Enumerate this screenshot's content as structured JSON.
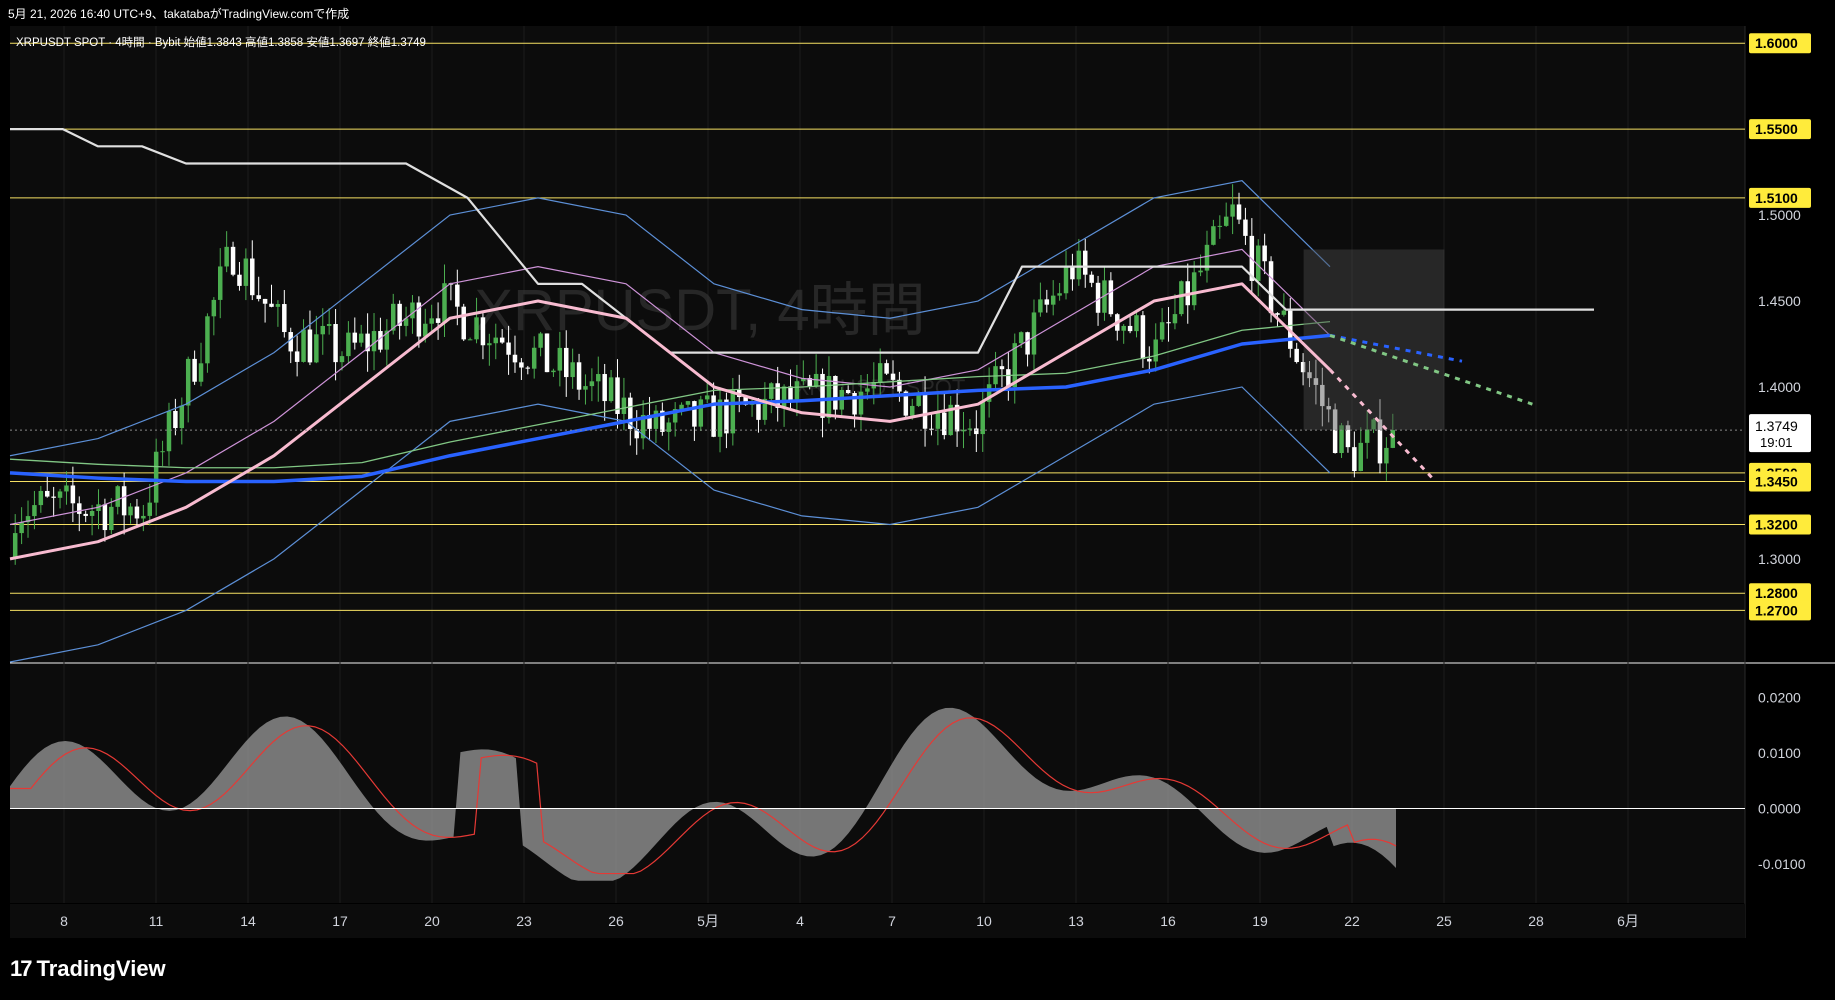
{
  "header": {
    "created_line": "5月 21, 2026 16:40 UTC+9、takatabaがTradingView.comで作成"
  },
  "legend": {
    "symbol": "XRPUSDT SPOT · 4時間 · Bybit",
    "open_label": "始値",
    "open": "1.3843",
    "high_label": "高値",
    "high": "1.3858",
    "low_label": "安値",
    "low": "1.3697",
    "close_label": "終値",
    "close": "1.3749"
  },
  "watermark": {
    "main": "XRPUSDT, 4時間",
    "sub": "XRPUSDT SPOT"
  },
  "footer": {
    "brand": "TradingView",
    "logo_icon": "tradingview-logo-icon"
  },
  "colors": {
    "background": "#000000",
    "pane_bg": "#0c0c0c",
    "grid": "#1c1c1c",
    "level_line": "#f5e063",
    "level_label_bg": "#ffeb3b",
    "bull_candle": "#4caf50",
    "bear_candle": "#ffffff",
    "ma_blue": "#2962ff",
    "ma_pink": "#f8bbd0",
    "ma_green": "#81c784",
    "ma_purple": "#ce93d8",
    "ma_white": "#e0e0e0",
    "bollinger": "#5c8fd6",
    "cloud": "#4a4a4a",
    "osc_fill": "#8a8a8a",
    "osc_signal": "#e53935",
    "price_label_bg": "#ffffff"
  },
  "chart_data": [
    {
      "type": "line",
      "pane": "price",
      "x_ticks": [
        "8",
        "11",
        "14",
        "17",
        "20",
        "23",
        "26",
        "5月",
        "4",
        "7",
        "10",
        "13",
        "16",
        "19",
        "22",
        "25",
        "28",
        "6月"
      ],
      "y_ticks": [
        "1.3000",
        "1.4000",
        "1.4500",
        "1.5000"
      ],
      "ylim": [
        1.24,
        1.61
      ],
      "horizontal_levels": [
        1.6,
        1.55,
        1.51,
        1.35,
        1.345,
        1.32,
        1.28,
        1.27
      ],
      "level_labels": [
        "1.6000",
        "1.5500",
        "1.5100",
        "1.3500",
        "1.3450",
        "1.3200",
        "1.2800",
        "1.2700"
      ],
      "current_price": {
        "value": 1.3749,
        "label": "1.3749",
        "countdown": "19:01"
      },
      "series": [
        {
          "name": "",
          "color_key": "ma_white",
          "x": [
            0,
            0.6,
            1,
            1.5,
            2,
            3,
            4.5,
            5.2,
            6,
            6.5,
            7.5,
            8.5,
            9,
            10,
            11,
            11.5,
            12,
            13,
            13.5,
            14,
            14.5,
            15,
            16,
            17,
            18
          ],
          "y": [
            1.55,
            1.55,
            1.54,
            1.54,
            1.53,
            1.53,
            1.53,
            1.51,
            1.46,
            1.46,
            1.42,
            1.42,
            1.42,
            1.42,
            1.42,
            1.47,
            1.47,
            1.47,
            1.47,
            1.47,
            1.445,
            1.445,
            1.445,
            1.445,
            1.445
          ]
        },
        {
          "name": "",
          "color_key": "ma_blue",
          "x": [
            0,
            1,
            2,
            3,
            4,
            5,
            6,
            7,
            8,
            9,
            10,
            11,
            12,
            13,
            14,
            15
          ],
          "y": [
            1.35,
            1.347,
            1.345,
            1.345,
            1.348,
            1.36,
            1.37,
            1.38,
            1.39,
            1.392,
            1.395,
            1.398,
            1.4,
            1.41,
            1.425,
            1.43
          ]
        },
        {
          "name": "",
          "color_key": "ma_pink",
          "x": [
            0,
            1,
            2,
            3,
            4,
            5,
            6,
            7,
            8,
            9,
            10,
            11,
            12,
            13,
            14,
            15
          ],
          "y": [
            1.3,
            1.31,
            1.33,
            1.36,
            1.4,
            1.44,
            1.45,
            1.44,
            1.4,
            1.385,
            1.38,
            1.39,
            1.42,
            1.45,
            1.46,
            1.41
          ]
        }
      ],
      "candles_ohlc_from": 1.3,
      "candles_ohlc_to": 1.3749,
      "projections": [
        {
          "color_key": "ma_blue",
          "x": [
            15,
            16.5
          ],
          "y": [
            1.43,
            1.415
          ]
        },
        {
          "color_key": "ma_green",
          "x": [
            15,
            17.3
          ],
          "y": [
            1.43,
            1.39
          ]
        },
        {
          "color_key": "ma_pink",
          "x": [
            15,
            16.2
          ],
          "y": [
            1.41,
            1.345
          ]
        }
      ]
    },
    {
      "type": "area",
      "pane": "oscillator",
      "y_ticks": [
        "0.0200",
        "0.0100",
        "0.0000",
        "-0.0100"
      ],
      "ylim": [
        -0.017,
        0.026
      ],
      "zero_line": 0.0
    }
  ]
}
